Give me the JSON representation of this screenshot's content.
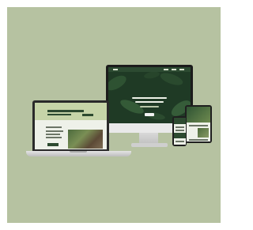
{
  "scene": {
    "description_visible_text": "",
    "colors": {
      "backdrop": "#b6c2a1",
      "brand_dark_green": "#2d4a30",
      "brand_light_green": "#c6d4a8"
    }
  },
  "devices": {
    "monitor": {
      "icon": "desktop-monitor-icon"
    },
    "laptop": {
      "icon": "laptop-icon"
    },
    "tablet": {
      "icon": "tablet-icon"
    },
    "phone": {
      "icon": "phone-icon"
    }
  }
}
